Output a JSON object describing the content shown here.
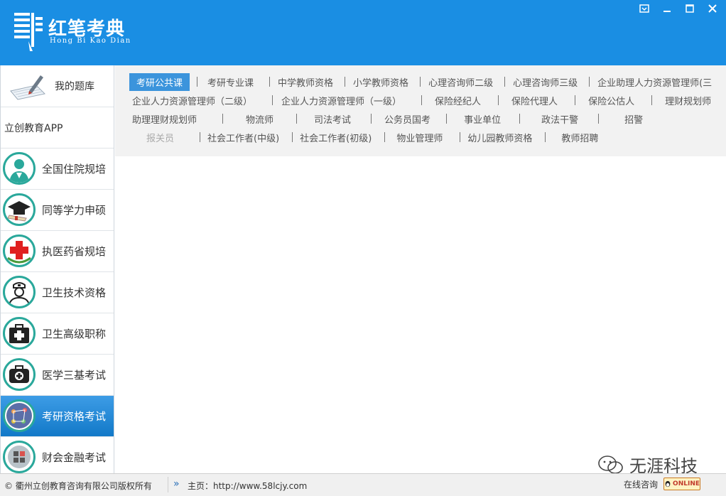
{
  "app": {
    "title": "红笔考典",
    "subtitle": "Hong Bi Kao Dian"
  },
  "window_controls": [
    "restore-down-icon",
    "minimize-icon",
    "maximize-icon",
    "close-icon"
  ],
  "sidebar": {
    "my_library": "我的题库",
    "app_label": "立创教育APP",
    "items": [
      {
        "label": "全国住院规培",
        "icon": "doctor-icon"
      },
      {
        "label": "同等学力申硕",
        "icon": "graduation-cap-icon"
      },
      {
        "label": "执医药省规培",
        "icon": "red-cross-icon"
      },
      {
        "label": "卫生技术资格",
        "icon": "nurse-icon"
      },
      {
        "label": "卫生高级职称",
        "icon": "medical-kit-icon"
      },
      {
        "label": "医学三基考试",
        "icon": "first-aid-icon"
      },
      {
        "label": "考研资格考试",
        "icon": "network-icon",
        "active": true
      },
      {
        "label": "财会金融考试",
        "icon": "calculator-icon"
      }
    ]
  },
  "nav": {
    "rows": [
      [
        "考研公共课",
        "考研专业课",
        "中学教师资格",
        "小学教师资格",
        "心理咨询师二级",
        "心理咨询师三级",
        "企业助理人力资源管理师(三"
      ],
      [
        "企业人力资源管理师（二级）",
        "企业人力资源管理师（一级）",
        "保险经纪人",
        "保险代理人",
        "保险公估人",
        "理财规划师"
      ],
      [
        "助理理财规划师",
        "物流师",
        "司法考试",
        "公务员国考",
        "事业单位",
        "政法干警",
        "招警"
      ],
      [
        "报关员",
        "社会工作者(中级)",
        "社会工作者(初级)",
        "物业管理师",
        "幼儿园教师资格",
        "教师招聘"
      ]
    ],
    "active": "考研公共课",
    "disabled": "报关员"
  },
  "footer": {
    "copyright": "© 衢州立创教育咨询有限公司版权所有",
    "home_label": "主页：http://www.58lcjy.com",
    "online_label": "在线咨询",
    "online_badge": "ONLINE"
  },
  "watermark": "无涯科技",
  "colors": {
    "header": "#1a8ee3",
    "active_tab": "#3b94dc",
    "accent": "#2aa89b"
  }
}
